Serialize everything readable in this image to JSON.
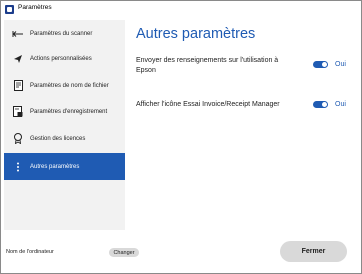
{
  "window": {
    "title": "Paramètres"
  },
  "sidebar": {
    "items": [
      {
        "label": "Paramètres du scanner",
        "icon": "arrow-left-line-icon"
      },
      {
        "label": "Actions personnalisées",
        "icon": "send-icon"
      },
      {
        "label": "Paramètres de nom de fichier",
        "icon": "document-icon"
      },
      {
        "label": "Paramètres d'enregistrement",
        "icon": "document-save-icon"
      },
      {
        "label": "Gestion des licences",
        "icon": "badge-icon"
      },
      {
        "label": "Autres paramètres",
        "icon": "more-vertical-icon",
        "active": true
      }
    ]
  },
  "main": {
    "title": "Autres paramètres",
    "settings": [
      {
        "label": "Envoyer des renseignements sur l'utilisation à Epson",
        "state": "Oui",
        "on": true
      },
      {
        "label": "Afficher l'icône Essai Invoice/Receipt Manager",
        "state": "Oui",
        "on": true
      }
    ]
  },
  "footer": {
    "computer_name_label": "Nom de l'ordinateur",
    "change_label": "Changer",
    "close_label": "Fermer"
  },
  "colors": {
    "accent": "#1f5bb3",
    "sidebar_bg": "#f2f2f2",
    "button_bg": "#d9d9d9"
  }
}
